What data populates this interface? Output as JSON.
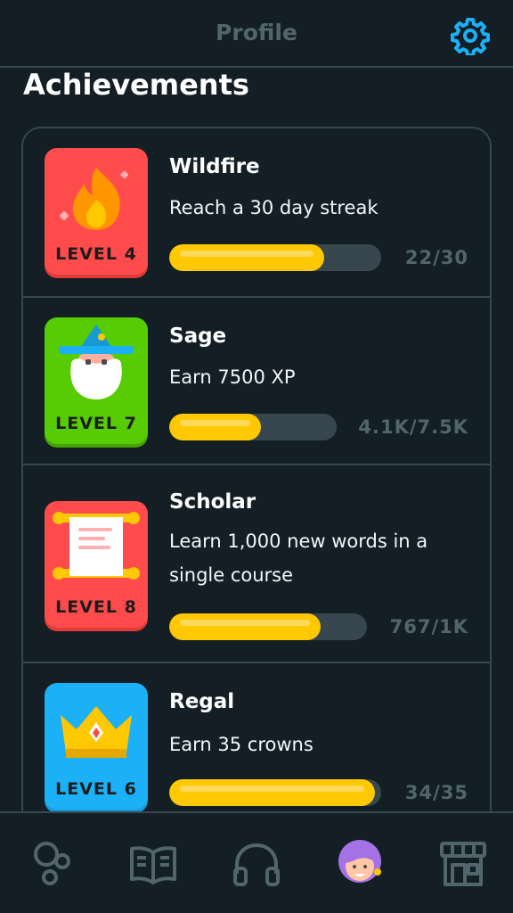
{
  "header": {
    "title": "Profile",
    "settings_icon": "gear-icon"
  },
  "section_title": "Achievements",
  "colors": {
    "accent": "#1cb0f6",
    "progress_fill": "#ffc800",
    "track": "#37464f",
    "muted": "#52656d"
  },
  "achievements": [
    {
      "title": "Wildfire",
      "description": "Reach a 30 day streak",
      "level": "LEVEL 4",
      "progress_text": "22/30",
      "progress_fraction": 0.733,
      "badge_color": "#ff4b4b",
      "icon": "fire-icon"
    },
    {
      "title": "Sage",
      "description": "Earn 7500 XP",
      "level": "LEVEL 7",
      "progress_text": "4.1K/7.5K",
      "progress_fraction": 0.547,
      "badge_color": "#58cc02",
      "icon": "wizard-icon"
    },
    {
      "title": "Scholar",
      "description": "Learn 1,000 new words in a single course",
      "level": "LEVEL 8",
      "progress_text": "767/1K",
      "progress_fraction": 0.767,
      "badge_color": "#ff4b4b",
      "icon": "scroll-icon"
    },
    {
      "title": "Regal",
      "description": "Earn 35 crowns",
      "level": "LEVEL 6",
      "progress_text": "34/35",
      "progress_fraction": 0.971,
      "badge_color": "#1cb0f6",
      "icon": "crown-icon"
    }
  ],
  "nav": [
    {
      "icon": "stories-icon"
    },
    {
      "icon": "book-icon"
    },
    {
      "icon": "headphones-icon"
    },
    {
      "icon": "profile-avatar-icon"
    },
    {
      "icon": "shop-icon"
    }
  ]
}
